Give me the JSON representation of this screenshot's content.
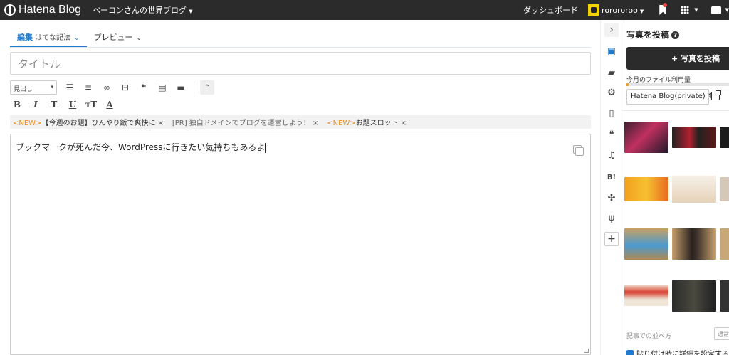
{
  "topbar": {
    "logo_text": "Hatena Blog",
    "blog_name": "ベーコンさんの世界ブログ",
    "dashboard": "ダッシュボード",
    "username": "rorororoo"
  },
  "editor": {
    "tabs": [
      {
        "label": "編集",
        "sub": "はてな記法"
      },
      {
        "label": "プレビュー"
      }
    ],
    "title_placeholder": "タイトル",
    "heading_select": "見出し",
    "body_text": "ブックマークが死んだ今、WordPressに行きたい気持ちもあるよ"
  },
  "notices": [
    {
      "tag": "<NEW>",
      "text": "【今週のお題】ひんやり飯で爽快に"
    },
    {
      "tag": "[PR]",
      "text": "独自ドメインでブログを運営しよう！"
    },
    {
      "tag": "<NEW>",
      "text": "お題スロット"
    }
  ],
  "panel": {
    "title": "写真を投稿",
    "post_button": "+ 写真を投稿",
    "usage_label": "今月のファイル利用量",
    "usage_fraction": 0.02,
    "blog_select": "Hatena Blog(private) ⇕",
    "sort_label": "記事での並べ方",
    "sort_button": "通常",
    "detail_checkbox": "貼り付け時に詳細を設定する"
  },
  "icons": [
    "collapse-chevron-icon",
    "photo-icon",
    "folder-icon",
    "gear-icon",
    "document-icon",
    "quote-icon",
    "twitter-icon",
    "hatena-bookmark-icon",
    "pinwheel-icon",
    "cutlery-icon",
    "plus-icon"
  ],
  "colors": {
    "accent": "#1e7bd0",
    "topbar": "#2b2b2b",
    "new_tag": "#f08c1e"
  }
}
